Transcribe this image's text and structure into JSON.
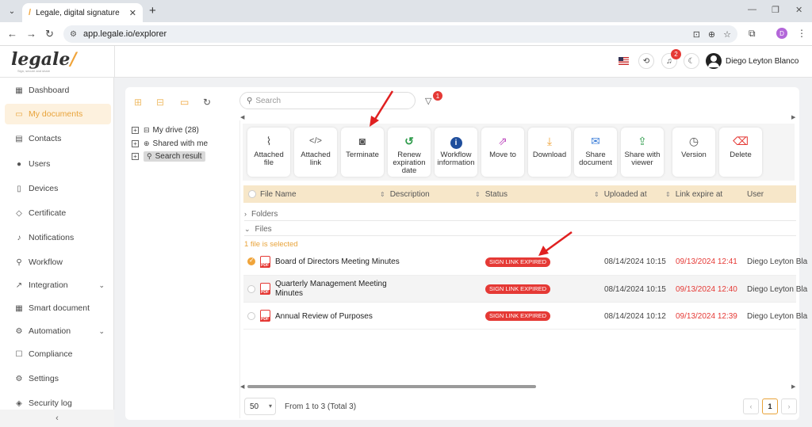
{
  "browser": {
    "tab_title": "Legale, digital signature",
    "url": "app.legale.io/explorer",
    "profile_initial": "D"
  },
  "header": {
    "logo_text": "legale",
    "tagline": "Sign, secure and share",
    "notifications_count": "2",
    "user_name": "Diego Leyton Blanco"
  },
  "sidebar": {
    "items": [
      {
        "label": "Dashboard",
        "icon": "dashboard-icon"
      },
      {
        "label": "My documents",
        "icon": "folder-icon"
      },
      {
        "label": "Contacts",
        "icon": "contacts-icon"
      },
      {
        "label": "Users",
        "icon": "user-icon"
      },
      {
        "label": "Devices",
        "icon": "device-icon"
      },
      {
        "label": "Certificate",
        "icon": "shield-icon"
      },
      {
        "label": "Notifications",
        "icon": "bell-icon"
      },
      {
        "label": "Workflow",
        "icon": "workflow-icon"
      },
      {
        "label": "Integration",
        "icon": "integration-icon"
      },
      {
        "label": "Smart document",
        "icon": "smart-document-icon"
      },
      {
        "label": "Automation",
        "icon": "automation-icon"
      },
      {
        "label": "Compliance",
        "icon": "compliance-icon"
      },
      {
        "label": "Settings",
        "icon": "gear-icon"
      },
      {
        "label": "Security log",
        "icon": "security-log-icon"
      }
    ],
    "active": "My documents"
  },
  "explorer": {
    "search_placeholder": "Search",
    "filter_count": "1",
    "tree": [
      {
        "label": "My drive (28)"
      },
      {
        "label": "Shared with me"
      },
      {
        "label": "Search result"
      }
    ],
    "actions": [
      {
        "label1": "Attached",
        "label2": "file",
        "label3": ""
      },
      {
        "label1": "Attached",
        "label2": "link",
        "label3": ""
      },
      {
        "label1": "Terminate",
        "label2": "",
        "label3": ""
      },
      {
        "label1": "Renew",
        "label2": "expiration",
        "label3": "date"
      },
      {
        "label1": "Workflow",
        "label2": "information",
        "label3": ""
      },
      {
        "label1": "Move to",
        "label2": "",
        "label3": ""
      },
      {
        "label1": "Download",
        "label2": "",
        "label3": ""
      },
      {
        "label1": "Share",
        "label2": "document",
        "label3": ""
      },
      {
        "label1": "Share with",
        "label2": "viewer",
        "label3": ""
      },
      {
        "label1": "Version",
        "label2": "",
        "label3": ""
      },
      {
        "label1": "Delete",
        "label2": "",
        "label3": ""
      }
    ],
    "columns": {
      "file_name": "File Name",
      "description": "Description",
      "status": "Status",
      "uploaded_at": "Uploaded at",
      "link_expire_at": "Link expire at",
      "user": "User"
    },
    "groups": {
      "folders": "Folders",
      "files": "Files"
    },
    "selection_note": "1 file is selected",
    "rows": [
      {
        "name1": "Board of Directors Meeting Minutes",
        "name2": "",
        "status": "SIGN LINK EXPIRED",
        "uploaded": "08/14/2024 10:15",
        "expire": "09/13/2024 12:41",
        "user": "Diego Leyton Bla",
        "selected": true
      },
      {
        "name1": "Quarterly Management Meeting",
        "name2": "Minutes",
        "status": "SIGN LINK EXPIRED",
        "uploaded": "08/14/2024 10:15",
        "expire": "09/13/2024 12:40",
        "user": "Diego Leyton Bla",
        "selected": false
      },
      {
        "name1": "Annual Review of Purposes",
        "name2": "",
        "status": "SIGN LINK EXPIRED",
        "uploaded": "08/14/2024 10:12",
        "expire": "09/13/2024 12:39",
        "user": "Diego Leyton Bla",
        "selected": false
      }
    ],
    "pagination": {
      "page_size": "50",
      "info": "From 1 to 3 (Total 3)",
      "current_page": "1"
    }
  },
  "colors": {
    "accent": "#f0a43a",
    "status_red": "#e53935",
    "header_row": "#f7e7c9"
  }
}
